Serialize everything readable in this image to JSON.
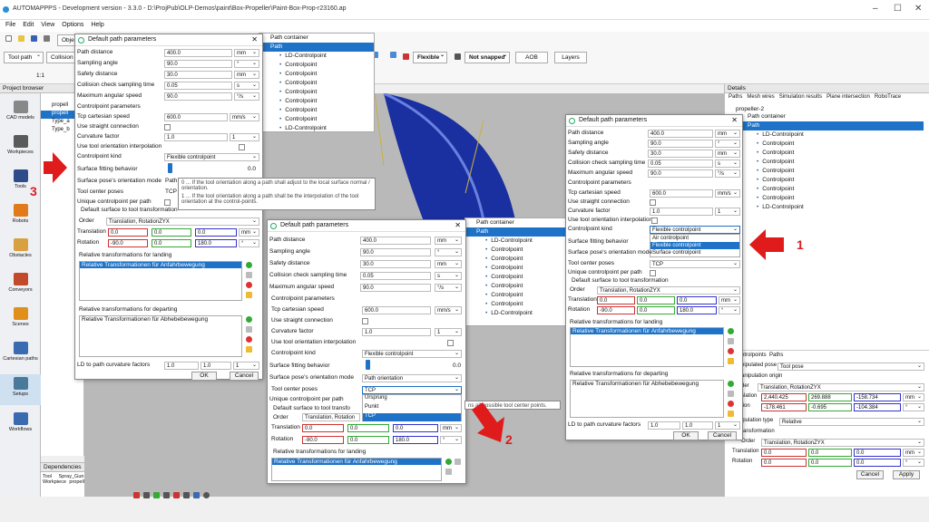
{
  "window": {
    "title": "AUTOMAPPPS - Development version - 3.3.0 - D:\\ProjPub\\OLP-Demos\\paint\\Box-Propeller\\Paint-Box-Prop-r23160.ap",
    "controls": [
      "–",
      "☐",
      "✕"
    ]
  },
  "menu": [
    "File",
    "Edit",
    "View",
    "Options",
    "Help"
  ],
  "toolbar": {
    "objects_label": "Objec",
    "tool_path": "Tool path",
    "collision": "Collision m",
    "zoom": "1:1",
    "flexible": "Flexible",
    "not_snapped": "Not snapped",
    "aob": "AOB",
    "layers": "Layers"
  },
  "project_browser": {
    "title": "Project browser",
    "items": [
      "propell",
      "propell",
      "Type_a",
      "Type_b"
    ]
  },
  "leftnav": [
    "CAD models",
    "Workpieces",
    "Tools",
    "Robots",
    "Obstacles",
    "Conveyors",
    "Scenes",
    "Cartesian paths",
    "Setups",
    "Workflows"
  ],
  "dependencies": {
    "title": "Dependencies",
    "rows": [
      {
        "k": "Tool",
        "v": "Spray_Gun"
      },
      {
        "k": "Workpiece",
        "v": "propeller"
      }
    ]
  },
  "dialog": {
    "title": "Default path parameters",
    "path_distance": "Path distance",
    "sampling_angle": "Sampling angle",
    "safety_distance": "Safety distance",
    "collision_time": "Collision check sampling time",
    "max_angular_speed": "Maximum angular speed",
    "cp_params": "Controlpoint parameters",
    "tcp_speed": "Tcp cartesian speed",
    "straight": "Use straight connection",
    "curvature": "Curvature factor",
    "tool_orient_interp": "Use tool orientation interpolation",
    "cp_kind": "Controlpoint kind",
    "surface_fit": "Surface fitting behavior",
    "orient_mode": "Surface pose's orientation mode",
    "tool_center": "Tool center poses",
    "unique_cp": "Unique controlpoint per path",
    "default_surface": "Default surface to tool transformation",
    "default_surface_short": "Default surface to tool transfo",
    "order": "Order",
    "order_val": "Translation, RotationZYX",
    "order_val_short": "Translation, Rotation",
    "translation": "Translation",
    "rotation": "Rotation",
    "landing": "Relative transformations for landing",
    "landing_item": "Relative Transformationen für Anfahrbewegung",
    "departing": "Relative transformations for departing",
    "departing_item": "Relative Transformationen für Abhebebewegung",
    "ld_factors": "LD to path curvature factors",
    "ok": "OK",
    "cancel": "Cancel",
    "units": {
      "mm": "mm",
      "deg": "°",
      "s": "s",
      "degs": "°/s",
      "mms": "mm/s"
    }
  },
  "dlg1": {
    "v_dist": "400.0",
    "v_angle": "90.0",
    "v_safe": "30.0",
    "v_coll": "0.05",
    "v_maxang": "90.0",
    "v_tcp": "600.0",
    "v_curv": "1.0",
    "v_curv2": "1",
    "v_kind": "Flexible controlpoint",
    "v_fit": "0.0",
    "v_orient": "Path",
    "v_tcpval": "TCP",
    "t": [
      "0.0",
      "0.0",
      "0.0"
    ],
    "r": [
      "-90.0",
      "0.0",
      "180.0"
    ],
    "ld": [
      "1.0",
      "1.0",
      "1"
    ],
    "tip1": "0 ... If the tool orientation along a path shall adjust to the local surface normal / orientation.",
    "tip2": "1 ... If the tool orientation along a path shall be the interpolation of the tool orientation at the control-points."
  },
  "dlg2": {
    "v_dist": "400.0",
    "v_angle": "90.0",
    "v_safe": "30.0",
    "v_coll": "0.05",
    "v_maxang": "90.0",
    "v_tcp": "600.0",
    "v_curv": "1.0",
    "v_curv2": "1",
    "v_kind": "Flexible controlpoint",
    "v_fit": "0.0",
    "v_orient": "Path orientation",
    "v_tcpval": "TCP",
    "options": [
      "Ursprung",
      "Punkt",
      "TCP"
    ],
    "t": [
      "0.0",
      "0.0",
      "0.0"
    ],
    "r": [
      "-90.0",
      "0.0",
      "180.0"
    ],
    "hint": "ns all possible tool center points."
  },
  "dlg3": {
    "v_dist": "400.0",
    "v_angle": "90.0",
    "v_safe": "30.0",
    "v_coll": "0.05",
    "v_maxang": "90.0",
    "v_tcp": "600.0",
    "v_curv": "1.0",
    "v_curv2": "1",
    "v_kind": "Flexible controlpoint",
    "v_tcpval": "TCP",
    "options": [
      "Air controlpoint",
      "Flexible controlpoint",
      "Surface controlpoint"
    ],
    "t": [
      "0.0",
      "0.0",
      "0.0"
    ],
    "r": [
      "-90.0",
      "0.0",
      "180.0"
    ],
    "ld": [
      "1.0",
      "1.0",
      "1"
    ]
  },
  "path_tree": {
    "container": "Path container",
    "path": "Path",
    "ld": "LD-Controlpoint",
    "cp": "Controlpoint"
  },
  "details": {
    "title": "Details",
    "tabs": [
      "Paths",
      "Mesh wires",
      "Simulation results",
      "Plane intersection",
      "RoboTrace"
    ],
    "root": "propeller-2",
    "sub_tabs": [
      "ntrolpoints",
      "Paths"
    ],
    "manip_pose_label": "nipulated pose",
    "manip_pose_val": "Tool pose",
    "manip_origin": "anipulation origin",
    "order": "der",
    "order_val": "Translation, RotationZYX",
    "trans_label": "slation",
    "trans": [
      "2,440.425",
      "269.888",
      "-158.734"
    ],
    "rot_label": "tion",
    "rot": [
      "-178.461",
      "-0.695",
      "-104.384"
    ],
    "manip_type": "ipulation type",
    "manip_type_val": "Relative",
    "transformation": "ransformation",
    "order2": "Order",
    "order2_val": "Translation, RotationZYX",
    "trans2_label": "Translation",
    "trans2": [
      "0.0",
      "0.0",
      "0.0"
    ],
    "rot2_label": "Rotation",
    "rot2": [
      "0.0",
      "0.0",
      "0.0"
    ],
    "cancel": "Cancel",
    "apply": "Apply"
  },
  "callouts": {
    "c1": "1",
    "c2": "2",
    "c3": "3"
  },
  "colors": {
    "accent": "#1e73c8",
    "arrow": "#e01b1b"
  }
}
